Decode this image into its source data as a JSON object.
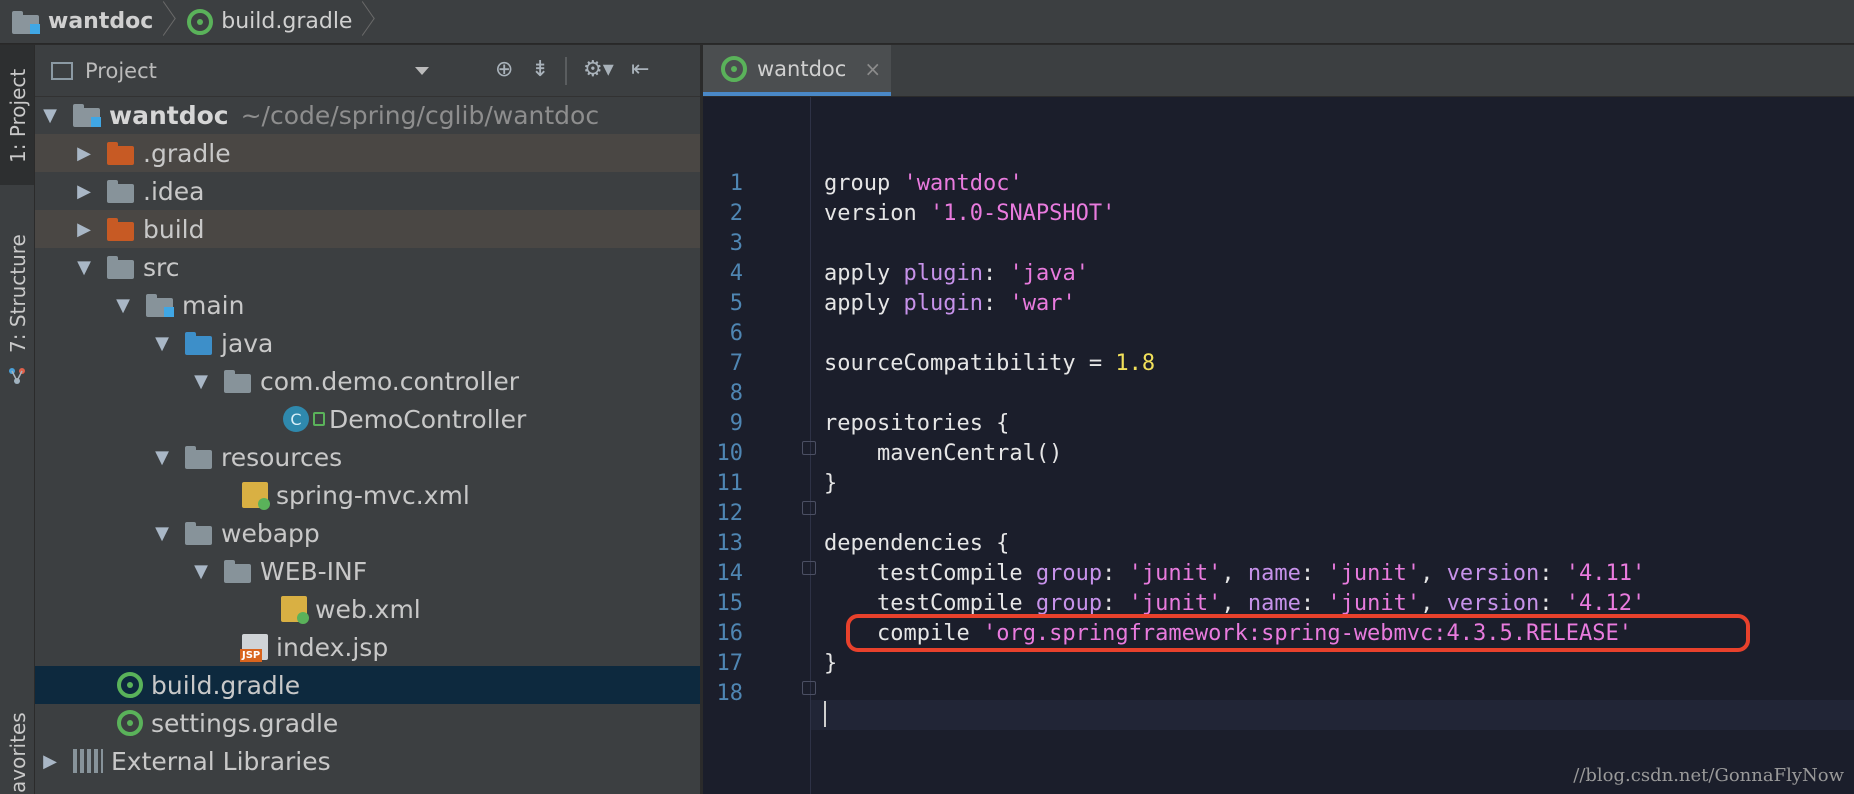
{
  "breadcrumb": {
    "project": "wantdoc",
    "file": "build.gradle"
  },
  "side_tabs": {
    "project": "1: Project",
    "structure": "7: Structure",
    "favorites": "avorites"
  },
  "project_panel": {
    "title": "Project",
    "tree": [
      {
        "label": "wantdoc",
        "suffix": "~/code/spring/cglib/wantdoc"
      },
      {
        "label": ".gradle"
      },
      {
        "label": ".idea"
      },
      {
        "label": "build"
      },
      {
        "label": "src"
      },
      {
        "label": "main"
      },
      {
        "label": "java"
      },
      {
        "label": "com.demo.controller"
      },
      {
        "label": "DemoController",
        "icon_letter": "C"
      },
      {
        "label": "resources"
      },
      {
        "label": "spring-mvc.xml"
      },
      {
        "label": "webapp"
      },
      {
        "label": "WEB-INF"
      },
      {
        "label": "web.xml"
      },
      {
        "label": "index.jsp",
        "badge": "JSP"
      },
      {
        "label": "build.gradle"
      },
      {
        "label": "settings.gradle"
      },
      {
        "label": "External Libraries"
      }
    ]
  },
  "editor": {
    "tab": {
      "label": "wantdoc",
      "close": "×"
    },
    "line_numbers": [
      "1",
      "2",
      "3",
      "4",
      "5",
      "6",
      "7",
      "8",
      "9",
      "10",
      "11",
      "12",
      "13",
      "14",
      "15",
      "16",
      "17",
      "18"
    ],
    "code": {
      "l1": {
        "a": "group ",
        "b": "'wantdoc'"
      },
      "l2": {
        "a": "version ",
        "b": "'1.0-SNAPSHOT'"
      },
      "l4": {
        "a": "apply ",
        "k": "plugin",
        "c": ": ",
        "b": "'java'"
      },
      "l5": {
        "a": "apply ",
        "k": "plugin",
        "c": ": ",
        "b": "'war'"
      },
      "l7": {
        "a": "sourceCompatibility = ",
        "n": "1.8"
      },
      "l9": "repositories {",
      "l10": "    mavenCentral()",
      "l11": "}",
      "l13": "dependencies {",
      "l14": {
        "a": "    testCompile ",
        "k1": "group",
        "c1": ": ",
        "s1": "'junit'",
        "c2": ", ",
        "k2": "name",
        "c3": ": ",
        "s2": "'junit'",
        "c4": ", ",
        "k3": "version",
        "c5": ": ",
        "s3": "'4.11'"
      },
      "l15": {
        "a": "    testCompile ",
        "k1": "group",
        "c1": ": ",
        "s1": "'junit'",
        "c2": ", ",
        "k2": "name",
        "c3": ": ",
        "s2": "'junit'",
        "c4": ", ",
        "k3": "version",
        "c5": ": ",
        "s3": "'4.12'"
      },
      "l16": {
        "a": "    compile ",
        "b": "'org.springframework:spring-webmvc:4.3.5.RELEASE'"
      },
      "l17": "}"
    }
  },
  "watermark": "//blog.csdn.net/GonnaFlyNow",
  "colors": {
    "accent": "#4a88c7",
    "callout": "#e8412c",
    "string": "#e97bde",
    "keyword": "#c792ea",
    "number": "#f1e05a"
  }
}
